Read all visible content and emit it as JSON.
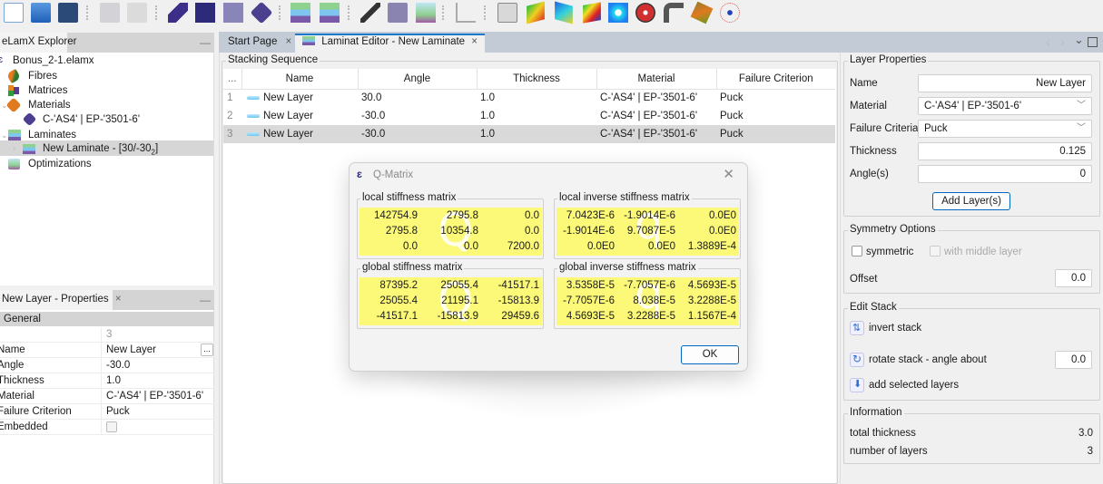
{
  "toolbar": {
    "buttons": [
      {
        "icon": "new-file-icon"
      },
      {
        "icon": "open-folder-icon"
      },
      {
        "icon": "save-icon"
      },
      {
        "icon": "import-icon"
      },
      {
        "icon": "export-icon"
      },
      {
        "icon": "add-fibre-icon"
      },
      {
        "icon": "add-matrix-icon"
      },
      {
        "icon": "add-material-icon"
      },
      {
        "icon": "add-material-2-icon"
      },
      {
        "icon": "add-laminate-icon"
      },
      {
        "icon": "remove-laminate-icon"
      },
      {
        "icon": "pen-icon"
      },
      {
        "icon": "cube-icon"
      },
      {
        "icon": "optimization-icon"
      },
      {
        "icon": "triangle-ruler-icon"
      },
      {
        "icon": "calculator-icon"
      },
      {
        "icon": "surface-plot-1-icon"
      },
      {
        "icon": "surface-plot-2-icon"
      },
      {
        "icon": "surface-plot-3-icon"
      },
      {
        "icon": "hole-plate-icon"
      },
      {
        "icon": "wheel-icon"
      },
      {
        "icon": "pipe-elbow-icon"
      },
      {
        "icon": "beam-icon"
      },
      {
        "icon": "network-icon"
      }
    ]
  },
  "explorer": {
    "title": "eLamX Explorer",
    "minimize": "—",
    "items": [
      {
        "label": "Bonus_2-1.elamx",
        "icon": "project-icon"
      },
      {
        "label": "Fibres",
        "icon": "fibres-icon"
      },
      {
        "label": "Matrices",
        "icon": "matrices-icon"
      },
      {
        "label": "Materials",
        "icon": "materials-icon"
      },
      {
        "label": "C-'AS4' | EP-'3501-6'",
        "icon": "material-item-icon"
      },
      {
        "label": "Laminates",
        "icon": "laminates-icon"
      },
      {
        "label": "New Laminate - [30/-30",
        "subscript": "2",
        "suffix": "]",
        "icon": "laminate-item-icon"
      },
      {
        "label": "Optimizations",
        "icon": "optimizations-icon"
      }
    ]
  },
  "properties": {
    "title": "New Layer - Properties",
    "close": "×",
    "minimize": "—",
    "section": "General",
    "index_value": "3",
    "rows": [
      {
        "key": "Name",
        "value": "New Layer",
        "has_button": true,
        "button": "..."
      },
      {
        "key": "Angle",
        "value": "-30.0"
      },
      {
        "key": "Thickness",
        "value": "1.0"
      },
      {
        "key": "Material",
        "value": "C-'AS4' | EP-'3501-6'"
      },
      {
        "key": "Failure Criterion",
        "value": "Puck"
      },
      {
        "key": "Embedded",
        "value": "",
        "checkbox": false
      }
    ]
  },
  "editor": {
    "tabs": [
      {
        "label": "Start Page",
        "close": "×",
        "active": false
      },
      {
        "label": "Laminat Editor - New Laminate",
        "close": "×",
        "active": true
      }
    ],
    "window_controls": {
      "prev": "‹",
      "next": "›",
      "menu": "⌄",
      "maximize": "☐"
    },
    "stacking": {
      "legend": "Stacking Sequence",
      "columns": [
        "...",
        "Name",
        "Angle",
        "Thickness",
        "Material",
        "Failure Criterion"
      ],
      "rows": [
        {
          "num": "1",
          "name": "New Layer",
          "angle": "30.0",
          "thickness": "1.0",
          "material": "C-'AS4' | EP-'3501-6'",
          "criterion": "Puck",
          "selected": false
        },
        {
          "num": "2",
          "name": "New Layer",
          "angle": "-30.0",
          "thickness": "1.0",
          "material": "C-'AS4' | EP-'3501-6'",
          "criterion": "Puck",
          "selected": false
        },
        {
          "num": "3",
          "name": "New Layer",
          "angle": "-30.0",
          "thickness": "1.0",
          "material": "C-'AS4' | EP-'3501-6'",
          "criterion": "Puck",
          "selected": true
        }
      ]
    }
  },
  "layer_properties": {
    "legend": "Layer Properties",
    "name_label": "Name",
    "name_value": "New Layer",
    "material_label": "Material",
    "material_value": "C-'AS4' | EP-'3501-6'",
    "criteria_label": "Failure Criteria",
    "criteria_value": "Puck",
    "thickness_label": "Thickness",
    "thickness_value": "0.125",
    "angles_label": "Angle(s)",
    "angles_value": "0",
    "add_button": "Add Layer(s)"
  },
  "symmetry": {
    "legend": "Symmetry Options",
    "symmetric_label": "symmetric",
    "symmetric_checked": false,
    "middle_label": "with middle layer",
    "middle_checked": false,
    "middle_enabled": false,
    "offset_label": "Offset",
    "offset_value": "0.0"
  },
  "edit_stack": {
    "legend": "Edit Stack",
    "invert": "invert stack",
    "rotate": "rotate stack - angle about",
    "rotate_value": "0.0",
    "add_selected": "add selected layers"
  },
  "information": {
    "legend": "Information",
    "total_thickness_label": "total thickness",
    "total_thickness_value": "3.0",
    "layers_label": "number of layers",
    "layers_value": "3"
  },
  "dialog": {
    "title": "Q-Matrix",
    "close": "✕",
    "ok": "OK",
    "watermark_q": "Q",
    "watermark_q_small": "q",
    "matrices": [
      {
        "legend": "local stiffness matrix",
        "values": [
          [
            "142754.9",
            "2795.8",
            "0.0"
          ],
          [
            "2795.8",
            "10354.8",
            "0.0"
          ],
          [
            "0.0",
            "0.0",
            "7200.0"
          ]
        ]
      },
      {
        "legend": "local inverse stiffness matrix",
        "values": [
          [
            "7.0423E-6",
            "-1.9014E-6",
            "0.0E0"
          ],
          [
            "-1.9014E-6",
            "9.7087E-5",
            "0.0E0"
          ],
          [
            "0.0E0",
            "0.0E0",
            "1.3889E-4"
          ]
        ]
      },
      {
        "legend": "global stiffness matrix",
        "values": [
          [
            "87395.2",
            "25055.4",
            "-41517.1"
          ],
          [
            "25055.4",
            "21195.1",
            "-15813.9"
          ],
          [
            "-41517.1",
            "-15813.9",
            "29459.6"
          ]
        ]
      },
      {
        "legend": "global inverse stiffness matrix",
        "values": [
          [
            "3.5358E-5",
            "-7.7057E-6",
            "4.5693E-5"
          ],
          [
            "-7.7057E-6",
            "8.038E-5",
            "3.2288E-5"
          ],
          [
            "4.5693E-5",
            "3.2288E-5",
            "1.1567E-4"
          ]
        ]
      }
    ]
  },
  "colors": {
    "matrix_bg": "#fbf977",
    "accent": "#0067c0",
    "tab_bar": "#c3ccd6",
    "selection": "#d9d9d9"
  }
}
